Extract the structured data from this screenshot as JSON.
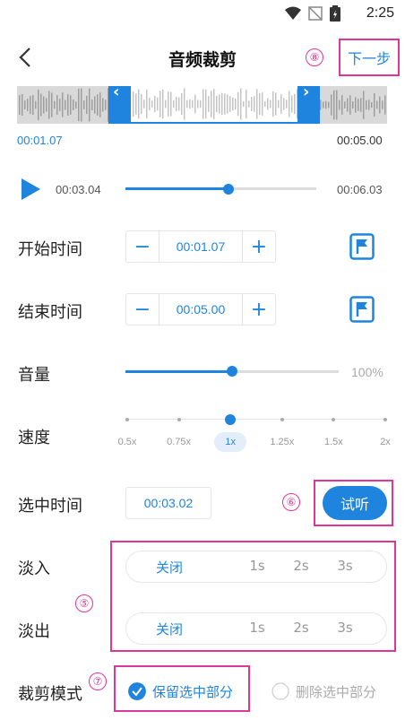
{
  "status": {
    "time": "2:25",
    "icons": [
      "wifi-icon",
      "no-signal-icon",
      "battery-icon"
    ]
  },
  "header": {
    "title": "音频裁剪",
    "next_label": "下一步",
    "back_icon": "chevron-left-icon"
  },
  "markers": {
    "m5": "⑤",
    "m6": "⑥",
    "m7": "⑦",
    "m8": "⑧"
  },
  "waveform": {
    "range_start": "00:01.07",
    "range_end": "00:05.00"
  },
  "player": {
    "current": "00:03.04",
    "total": "00:06.03",
    "progress": 0.54
  },
  "start_time": {
    "label": "开始时间",
    "value": "00:01.07"
  },
  "end_time": {
    "label": "结束时间",
    "value": "00:05.00"
  },
  "volume": {
    "label": "音量",
    "value": "100%",
    "level": 0.5
  },
  "speed": {
    "label": "速度",
    "options": [
      "0.5x",
      "0.75x",
      "1x",
      "1.25x",
      "1.5x",
      "2x"
    ],
    "selected": "1x"
  },
  "selection": {
    "label": "选中时间",
    "value": "00:03.02",
    "try_label": "试听"
  },
  "fade_in": {
    "label": "淡入",
    "options": [
      "关闭",
      "1s",
      "2s",
      "3s"
    ],
    "selected": "关闭"
  },
  "fade_out": {
    "label": "淡出",
    "options": [
      "关闭",
      "1s",
      "2s",
      "3s"
    ],
    "selected": "关闭"
  },
  "crop_mode": {
    "label": "裁剪模式",
    "keep_label": "保留选中部分",
    "delete_label": "删除选中部分",
    "selected": "keep"
  },
  "colors": {
    "accent": "#1f84dd",
    "annotation": "#e0359a"
  }
}
